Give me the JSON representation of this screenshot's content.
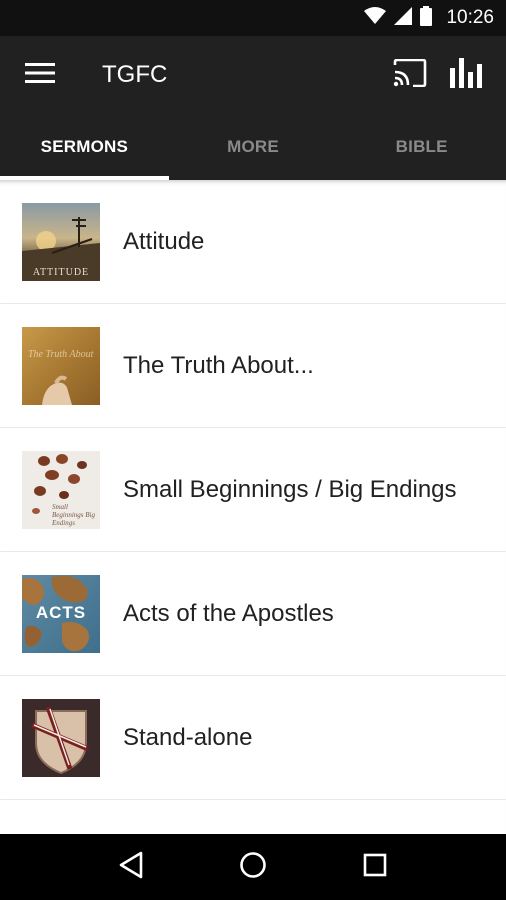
{
  "status_bar": {
    "time": "10:26",
    "icons": [
      "wifi-icon",
      "signal-icon",
      "battery-icon"
    ]
  },
  "app_bar": {
    "title": "TGFC",
    "menu_icon": "hamburger-menu-icon",
    "actions": [
      "cast-icon",
      "bar-chart-icon"
    ]
  },
  "tabs": [
    {
      "label": "SERMONS",
      "active": true
    },
    {
      "label": "MORE",
      "active": false
    },
    {
      "label": "BIBLE",
      "active": false
    }
  ],
  "sermons": [
    {
      "title": "Attitude",
      "thumb_caption": "ATTITUDE"
    },
    {
      "title": "The Truth About...",
      "thumb_caption": "The Truth About"
    },
    {
      "title": "Small Beginnings / Big Endings",
      "thumb_caption": "Small Beginnings Big Endings"
    },
    {
      "title": "Acts of the Apostles",
      "thumb_caption": "ACTS"
    },
    {
      "title": "Stand-alone",
      "thumb_caption": ""
    }
  ],
  "nav_bar": {
    "buttons": [
      "back-icon",
      "home-icon",
      "recents-icon"
    ]
  },
  "colors": {
    "status_bar": "#111111",
    "app_bar": "#212121",
    "tab_active": "#ffffff",
    "tab_inactive": "#8a8a8a",
    "nav_bar": "#000000"
  }
}
